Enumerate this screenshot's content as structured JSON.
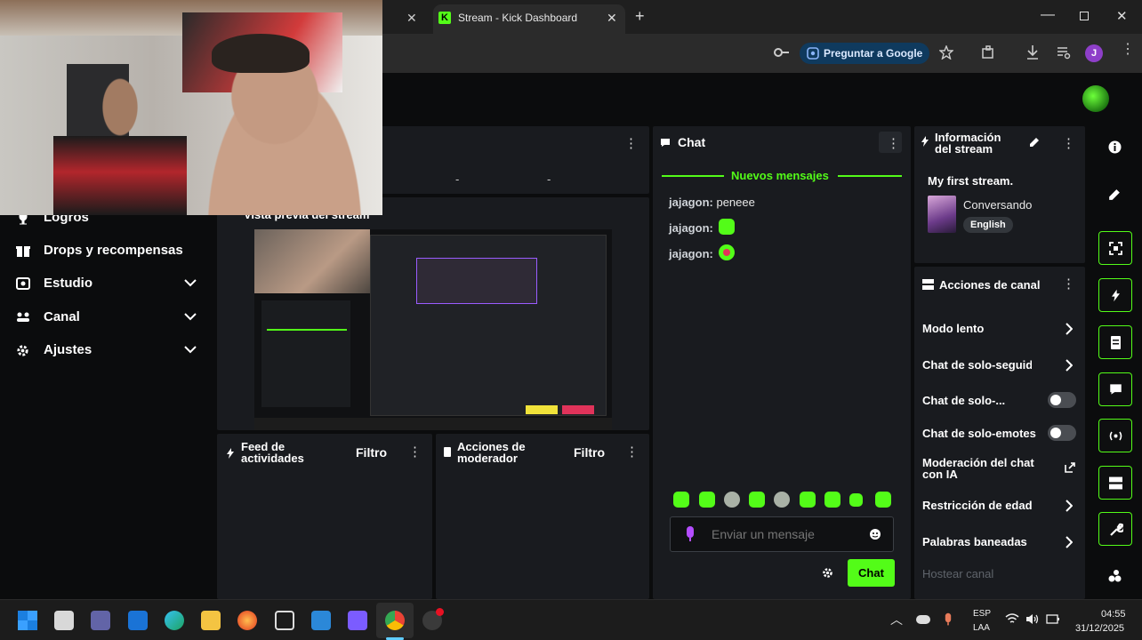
{
  "browser": {
    "active_tab_title": "Stream - Kick Dashboard",
    "ask_google_label": "Preguntar a Google",
    "profile_initial": "J"
  },
  "sidebar": {
    "items": [
      {
        "label": "Logros",
        "icon": "trophy-icon",
        "chevron": false
      },
      {
        "label": "Drops y recompensas",
        "icon": "gift-icon",
        "chevron": false
      },
      {
        "label": "Estudio",
        "icon": "studio-icon",
        "chevron": true
      },
      {
        "label": "Canal",
        "icon": "channel-icon",
        "chevron": true
      },
      {
        "label": "Ajustes",
        "icon": "gear-icon",
        "chevron": true
      }
    ]
  },
  "stats_panel": {
    "values": [
      "-",
      "-"
    ]
  },
  "preview": {
    "title": "Vista previa del stream"
  },
  "activity_feed": {
    "title": "Feed de actividades",
    "filter_label": "Filtro"
  },
  "mod_actions": {
    "title": "Acciones de moderador",
    "filter_label": "Filtro"
  },
  "chat": {
    "title": "Chat",
    "new_messages_label": "Nuevos mensajes",
    "messages": [
      {
        "user": "jajagon:",
        "text": "peneee",
        "emote": null
      },
      {
        "user": "jajagon:",
        "text": "",
        "emote": "green-emote"
      },
      {
        "user": "jajagon:",
        "text": "",
        "emote": "heart-emote"
      }
    ],
    "input_placeholder": "Enviar un mensaje",
    "send_label": "Chat"
  },
  "stream_info": {
    "title": "Información del stream",
    "stream_title": "My first stream.",
    "category": "Conversando",
    "language": "English"
  },
  "channel_actions": {
    "title": "Acciones de canal",
    "rows": [
      {
        "label": "Modo lento",
        "control": "chevron"
      },
      {
        "label": "Chat de solo-seguidores",
        "control": "chevron"
      },
      {
        "label": "Chat de solo-...",
        "control": "toggle"
      },
      {
        "label": "Chat de solo-emotes",
        "control": "toggle"
      },
      {
        "label": "Moderación del chat con IA",
        "control": "external"
      },
      {
        "label": "Restricción de edad",
        "control": "chevron"
      },
      {
        "label": "Palabras baneadas",
        "control": "chevron"
      }
    ],
    "host_label": "Hostear canal"
  },
  "taskbar": {
    "lang_top": "ESP",
    "lang_bottom": "LAA",
    "time": "04:55",
    "date": "31/12/2025"
  },
  "colors": {
    "accent": "#53fc18",
    "panel": "#191b1f",
    "background": "#0b0c0d"
  }
}
